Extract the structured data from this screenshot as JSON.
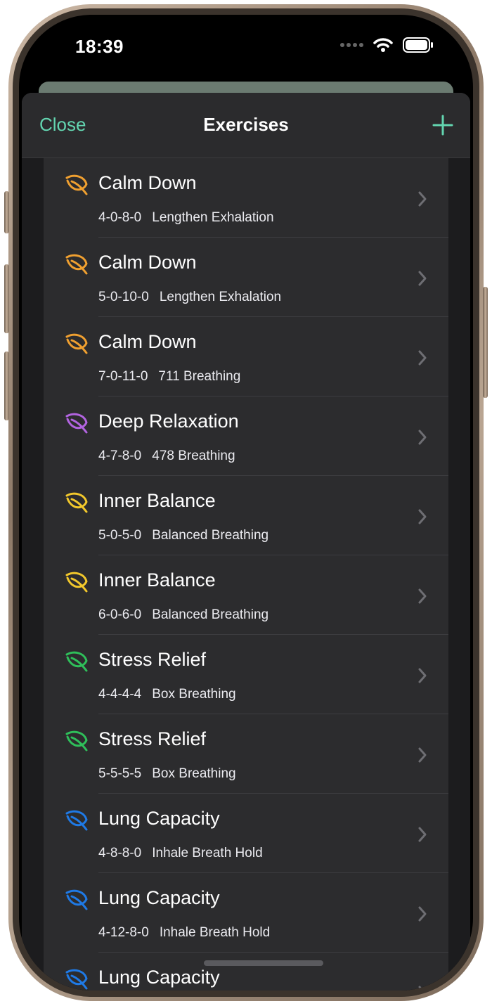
{
  "status_bar": {
    "time": "18:39",
    "signal_icon": "signal-dots-icon",
    "wifi_icon": "wifi-icon",
    "battery_icon": "battery-icon"
  },
  "nav": {
    "close_label": "Close",
    "title": "Exercises",
    "add_icon": "plus-icon",
    "accent": "#63d5b0"
  },
  "exercises": [
    {
      "title": "Calm Down",
      "pattern": "4-0-8-0",
      "technique": "Lengthen Exhalation",
      "color": "#f0a030"
    },
    {
      "title": "Calm Down",
      "pattern": "5-0-10-0",
      "technique": "Lengthen Exhalation",
      "color": "#f0a030"
    },
    {
      "title": "Calm Down",
      "pattern": "7-0-11-0",
      "technique": "711 Breathing",
      "color": "#f0a030"
    },
    {
      "title": "Deep Relaxation",
      "pattern": "4-7-8-0",
      "technique": "478 Breathing",
      "color": "#b264e0"
    },
    {
      "title": "Inner Balance",
      "pattern": "5-0-5-0",
      "technique": "Balanced Breathing",
      "color": "#f2c82c"
    },
    {
      "title": "Inner Balance",
      "pattern": "6-0-6-0",
      "technique": "Balanced Breathing",
      "color": "#f2c82c"
    },
    {
      "title": "Stress Relief",
      "pattern": "4-4-4-4",
      "technique": "Box Breathing",
      "color": "#2fbf5a"
    },
    {
      "title": "Stress Relief",
      "pattern": "5-5-5-5",
      "technique": "Box Breathing",
      "color": "#2fbf5a"
    },
    {
      "title": "Lung Capacity",
      "pattern": "4-8-8-0",
      "technique": "Inhale Breath Hold",
      "color": "#1f7ae6"
    },
    {
      "title": "Lung Capacity",
      "pattern": "4-12-8-0",
      "technique": "Inhale Breath Hold",
      "color": "#1f7ae6"
    },
    {
      "title": "Lung Capacity",
      "pattern": "",
      "technique": "",
      "color": "#1f7ae6"
    }
  ],
  "row_icons": {
    "leaf": "leaf-icon",
    "chevron": "chevron-right-icon"
  }
}
